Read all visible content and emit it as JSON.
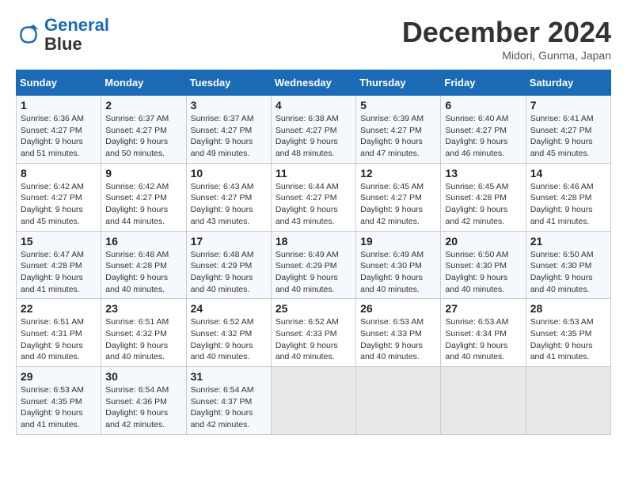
{
  "header": {
    "logo_line1": "General",
    "logo_line2": "Blue",
    "month": "December 2024",
    "location": "Midori, Gunma, Japan"
  },
  "weekdays": [
    "Sunday",
    "Monday",
    "Tuesday",
    "Wednesday",
    "Thursday",
    "Friday",
    "Saturday"
  ],
  "weeks": [
    [
      {
        "day": "1",
        "info": "Sunrise: 6:36 AM\nSunset: 4:27 PM\nDaylight: 9 hours\nand 51 minutes."
      },
      {
        "day": "2",
        "info": "Sunrise: 6:37 AM\nSunset: 4:27 PM\nDaylight: 9 hours\nand 50 minutes."
      },
      {
        "day": "3",
        "info": "Sunrise: 6:37 AM\nSunset: 4:27 PM\nDaylight: 9 hours\nand 49 minutes."
      },
      {
        "day": "4",
        "info": "Sunrise: 6:38 AM\nSunset: 4:27 PM\nDaylight: 9 hours\nand 48 minutes."
      },
      {
        "day": "5",
        "info": "Sunrise: 6:39 AM\nSunset: 4:27 PM\nDaylight: 9 hours\nand 47 minutes."
      },
      {
        "day": "6",
        "info": "Sunrise: 6:40 AM\nSunset: 4:27 PM\nDaylight: 9 hours\nand 46 minutes."
      },
      {
        "day": "7",
        "info": "Sunrise: 6:41 AM\nSunset: 4:27 PM\nDaylight: 9 hours\nand 45 minutes."
      }
    ],
    [
      {
        "day": "8",
        "info": "Sunrise: 6:42 AM\nSunset: 4:27 PM\nDaylight: 9 hours\nand 45 minutes."
      },
      {
        "day": "9",
        "info": "Sunrise: 6:42 AM\nSunset: 4:27 PM\nDaylight: 9 hours\nand 44 minutes."
      },
      {
        "day": "10",
        "info": "Sunrise: 6:43 AM\nSunset: 4:27 PM\nDaylight: 9 hours\nand 43 minutes."
      },
      {
        "day": "11",
        "info": "Sunrise: 6:44 AM\nSunset: 4:27 PM\nDaylight: 9 hours\nand 43 minutes."
      },
      {
        "day": "12",
        "info": "Sunrise: 6:45 AM\nSunset: 4:27 PM\nDaylight: 9 hours\nand 42 minutes."
      },
      {
        "day": "13",
        "info": "Sunrise: 6:45 AM\nSunset: 4:28 PM\nDaylight: 9 hours\nand 42 minutes."
      },
      {
        "day": "14",
        "info": "Sunrise: 6:46 AM\nSunset: 4:28 PM\nDaylight: 9 hours\nand 41 minutes."
      }
    ],
    [
      {
        "day": "15",
        "info": "Sunrise: 6:47 AM\nSunset: 4:28 PM\nDaylight: 9 hours\nand 41 minutes."
      },
      {
        "day": "16",
        "info": "Sunrise: 6:48 AM\nSunset: 4:28 PM\nDaylight: 9 hours\nand 40 minutes."
      },
      {
        "day": "17",
        "info": "Sunrise: 6:48 AM\nSunset: 4:29 PM\nDaylight: 9 hours\nand 40 minutes."
      },
      {
        "day": "18",
        "info": "Sunrise: 6:49 AM\nSunset: 4:29 PM\nDaylight: 9 hours\nand 40 minutes."
      },
      {
        "day": "19",
        "info": "Sunrise: 6:49 AM\nSunset: 4:30 PM\nDaylight: 9 hours\nand 40 minutes."
      },
      {
        "day": "20",
        "info": "Sunrise: 6:50 AM\nSunset: 4:30 PM\nDaylight: 9 hours\nand 40 minutes."
      },
      {
        "day": "21",
        "info": "Sunrise: 6:50 AM\nSunset: 4:30 PM\nDaylight: 9 hours\nand 40 minutes."
      }
    ],
    [
      {
        "day": "22",
        "info": "Sunrise: 6:51 AM\nSunset: 4:31 PM\nDaylight: 9 hours\nand 40 minutes."
      },
      {
        "day": "23",
        "info": "Sunrise: 6:51 AM\nSunset: 4:32 PM\nDaylight: 9 hours\nand 40 minutes."
      },
      {
        "day": "24",
        "info": "Sunrise: 6:52 AM\nSunset: 4:32 PM\nDaylight: 9 hours\nand 40 minutes."
      },
      {
        "day": "25",
        "info": "Sunrise: 6:52 AM\nSunset: 4:33 PM\nDaylight: 9 hours\nand 40 minutes."
      },
      {
        "day": "26",
        "info": "Sunrise: 6:53 AM\nSunset: 4:33 PM\nDaylight: 9 hours\nand 40 minutes."
      },
      {
        "day": "27",
        "info": "Sunrise: 6:53 AM\nSunset: 4:34 PM\nDaylight: 9 hours\nand 40 minutes."
      },
      {
        "day": "28",
        "info": "Sunrise: 6:53 AM\nSunset: 4:35 PM\nDaylight: 9 hours\nand 41 minutes."
      }
    ],
    [
      {
        "day": "29",
        "info": "Sunrise: 6:53 AM\nSunset: 4:35 PM\nDaylight: 9 hours\nand 41 minutes."
      },
      {
        "day": "30",
        "info": "Sunrise: 6:54 AM\nSunset: 4:36 PM\nDaylight: 9 hours\nand 42 minutes."
      },
      {
        "day": "31",
        "info": "Sunrise: 6:54 AM\nSunset: 4:37 PM\nDaylight: 9 hours\nand 42 minutes."
      },
      null,
      null,
      null,
      null
    ]
  ]
}
